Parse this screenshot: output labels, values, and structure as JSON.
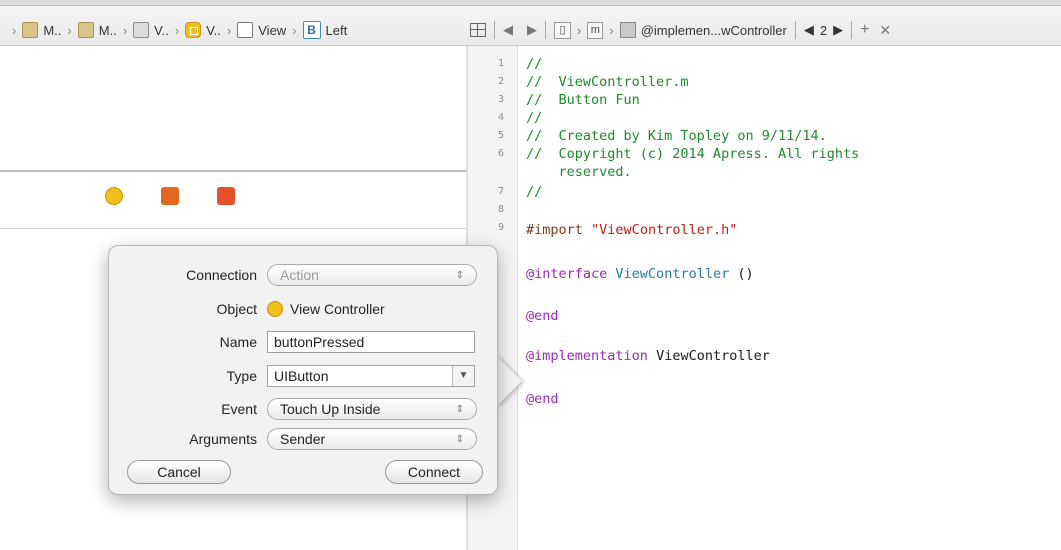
{
  "breadcrumbs": [
    {
      "icon": "file-icon",
      "label": "M.."
    },
    {
      "icon": "file-icon",
      "label": "M.."
    },
    {
      "icon": "storyboard-icon",
      "label": "V.."
    },
    {
      "icon": "view-controller-icon",
      "label": "V.."
    },
    {
      "icon": "view-icon",
      "label": "View"
    },
    {
      "icon": "button-icon",
      "label": "Left",
      "badge": "B"
    }
  ],
  "editor_bar": {
    "related_icon": "grid-icon",
    "back": "◀",
    "forward": "▶",
    "m_label": "m",
    "symbol": "@implemen...wController",
    "counter": "2",
    "add": "+",
    "close": "✕"
  },
  "popover": {
    "connection_label": "Connection",
    "connection_value": "Action",
    "object_label": "Object",
    "object_value": "View Controller",
    "name_label": "Name",
    "name_value": "buttonPressed",
    "type_label": "Type",
    "type_value": "UIButton",
    "event_label": "Event",
    "event_value": "Touch Up Inside",
    "arguments_label": "Arguments",
    "arguments_value": "Sender",
    "cancel": "Cancel",
    "connect": "Connect"
  },
  "code": {
    "line_numbers": [
      "1",
      "2",
      "3",
      "4",
      "5",
      "6",
      "",
      "7",
      "8",
      "9",
      "",
      "",
      "",
      "",
      "",
      "",
      ""
    ],
    "l1": "//",
    "l2": "//  ViewController.m",
    "l3": "//  Button Fun",
    "l4": "//",
    "l5": "//  Created by Kim Topley on 9/11/14.",
    "l6a": "//  Copyright (c) 2014 Apress. All rights",
    "l6b": "    reserved.",
    "l7": "//",
    "import_kw": "#import",
    "import_str": "\"ViewController.h\"",
    "interface_kw": "@interface",
    "interface_name": "ViewController",
    "interface_tail": " ()",
    "end1": "@end",
    "impl_kw": "@implementation",
    "impl_name": "ViewController",
    "end2": "@end"
  },
  "colors": {
    "comment": "#1d8a2e",
    "string": "#c41a16",
    "keyword": "#9a2bb5"
  }
}
